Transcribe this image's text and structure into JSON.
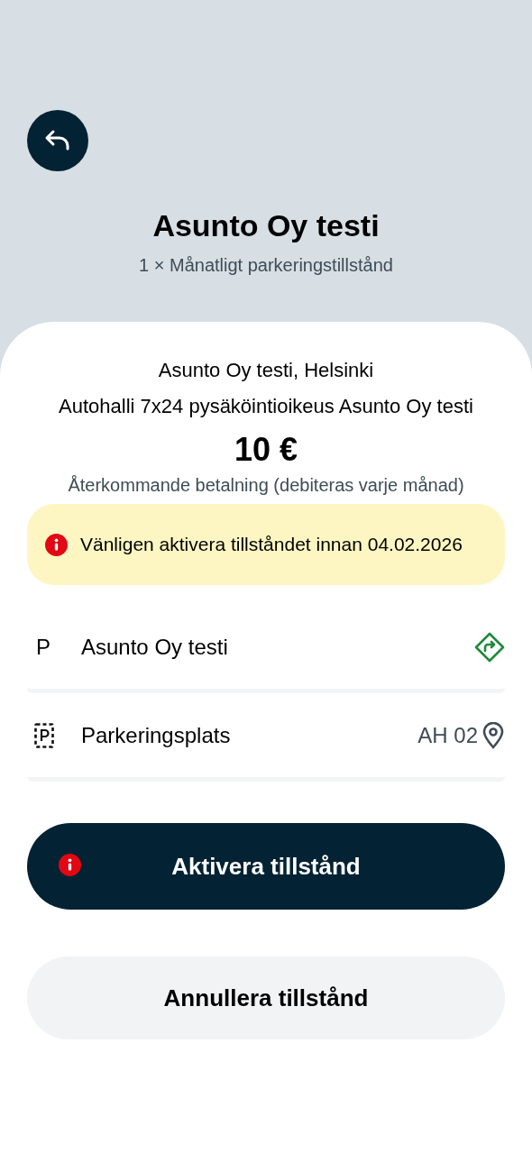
{
  "header": {
    "title": "Asunto Oy testi",
    "subtitle": "1 × Månatligt parkeringstillstånd"
  },
  "details": {
    "lines": [
      "Asunto Oy testi, Helsinki",
      "Autohalli 7x24 pysäköintioikeus Asunto Oy testi"
    ],
    "price": "10 €",
    "payment_note": "Återkommande betalning (debiteras varje månad)"
  },
  "alert": {
    "text": "Vänligen aktivera tillståndet innan 04.02.2026"
  },
  "rows": [
    {
      "kind": "location",
      "glyph": "P",
      "label": "Asunto Oy testi"
    },
    {
      "kind": "spot",
      "label": "Parkeringsplats",
      "value": "AH 02"
    }
  ],
  "buttons": [
    {
      "kind": "primary",
      "label": "Aktivera tillstånd",
      "warning": true
    },
    {
      "kind": "secondary",
      "label": "Annullera tillstånd",
      "warning": false
    }
  ]
}
